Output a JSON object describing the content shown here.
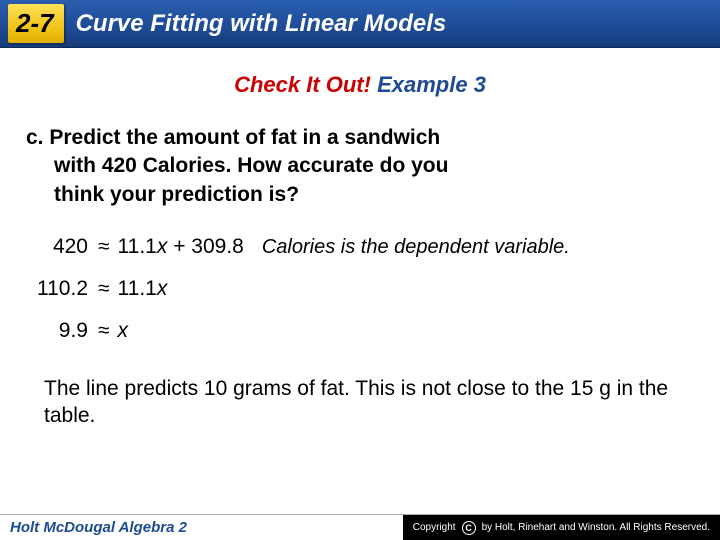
{
  "header": {
    "section_number": "2-7",
    "title": "Curve Fitting with Linear Models"
  },
  "check": {
    "red_text": "Check It Out!",
    "blue_text": "Example 3"
  },
  "prompt": {
    "label": "c.",
    "line1": "Predict the amount of fat in a sandwich",
    "line2": "with 420 Calories. How accurate do you",
    "line3": "think your prediction is?"
  },
  "equations": {
    "row1": {
      "left": "420",
      "approx": "≈",
      "right_a": "11.1",
      "right_b": " + 309.8"
    },
    "row2": {
      "left": "110.2",
      "approx": "≈",
      "right_a": "11.1"
    },
    "row3": {
      "left": "9.9",
      "approx": "≈"
    },
    "note": "Calories is the dependent variable."
  },
  "conclusion": "The line predicts 10 grams of fat. This is not close to the 15 g in the table.",
  "footer": {
    "left": "Holt McDougal Algebra 2",
    "right": "by Holt, Rinehart and Winston. All Rights Reserved."
  }
}
